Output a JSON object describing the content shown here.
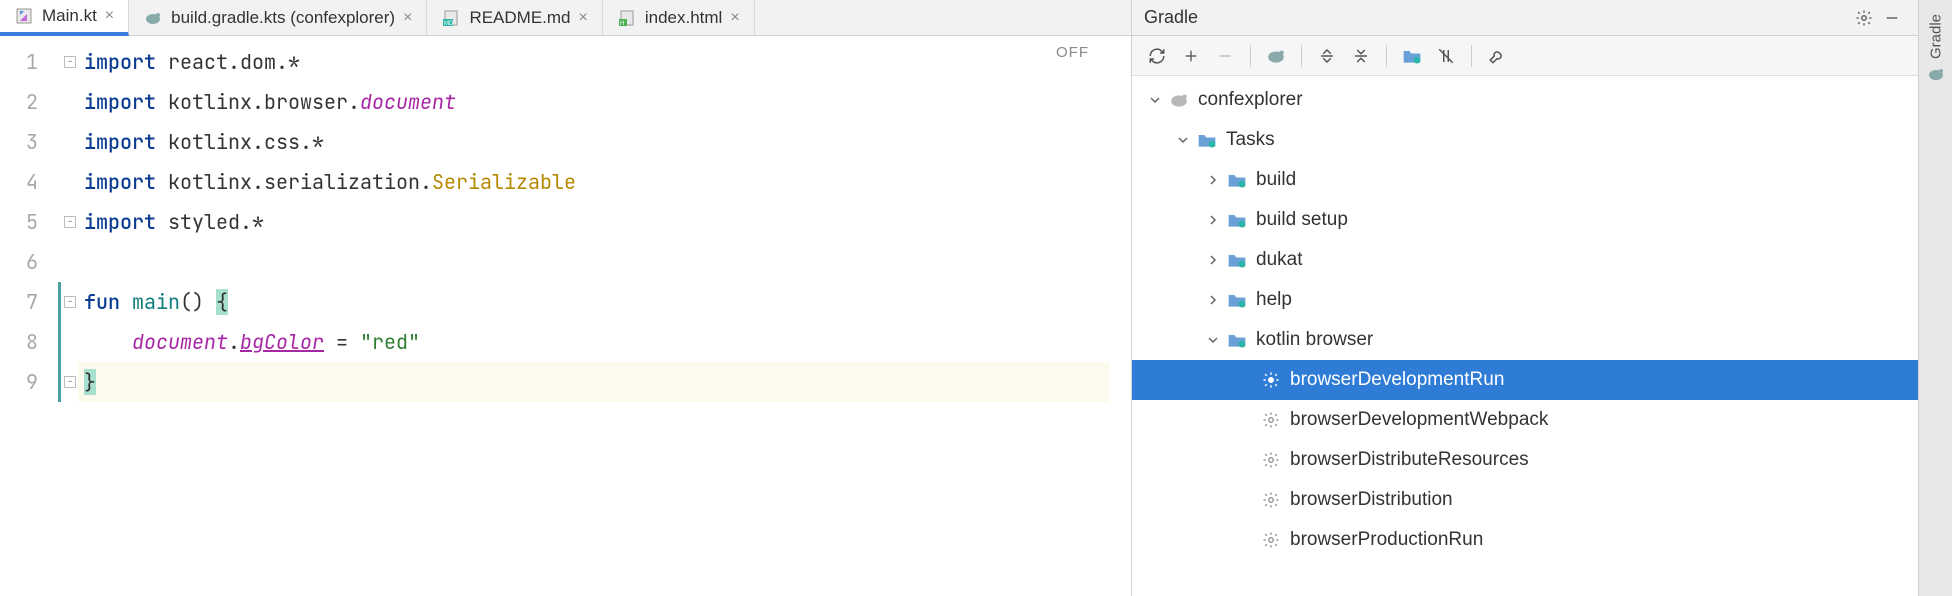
{
  "tabs": [
    {
      "label": "Main.kt",
      "icon": "kotlin-file-icon",
      "active": true
    },
    {
      "label": "build.gradle.kts (confexplorer)",
      "icon": "gradle-elephant-icon",
      "active": false
    },
    {
      "label": "README.md",
      "icon": "markdown-file-icon",
      "active": false
    },
    {
      "label": "index.html",
      "icon": "html-file-icon",
      "active": false
    }
  ],
  "editor": {
    "status_badge": "OFF",
    "lines": [
      "1",
      "2",
      "3",
      "4",
      "5",
      "6",
      "7",
      "8",
      "9"
    ],
    "tokens": {
      "import": "import",
      "fun": "fun",
      "main": "main",
      "react_dom": "react.dom.*",
      "kotlinx_browser": "kotlinx.browser.",
      "document": "document",
      "kotlinx_css": "kotlinx.css.*",
      "kotlinx_serialization": "kotlinx.serialization.",
      "serializable": "Serializable",
      "styled": "styled.*",
      "parens": "()",
      "lbrace": "{",
      "rbrace": "}",
      "dot": ".",
      "bgColor": "bgColor",
      "eq": " = ",
      "red": "\"red\""
    }
  },
  "gradle": {
    "title": "Gradle",
    "stripe_label": "Gradle",
    "toolbar_icons": [
      "refresh-icon",
      "add-icon",
      "remove-icon",
      "gradle-elephant-icon",
      "expand-all-icon",
      "collapse-all-icon",
      "folder-gear-icon",
      "offline-icon",
      "wrench-icon"
    ],
    "tree": {
      "root": "confexplorer",
      "tasks_label": "Tasks",
      "groups": [
        {
          "name": "build",
          "expanded": false
        },
        {
          "name": "build setup",
          "expanded": false
        },
        {
          "name": "dukat",
          "expanded": false
        },
        {
          "name": "help",
          "expanded": false
        }
      ],
      "kotlin_browser": {
        "label": "kotlin browser",
        "tasks": [
          "browserDevelopmentRun",
          "browserDevelopmentWebpack",
          "browserDistributeResources",
          "browserDistribution",
          "browserProductionRun"
        ],
        "selected_index": 0
      }
    }
  }
}
